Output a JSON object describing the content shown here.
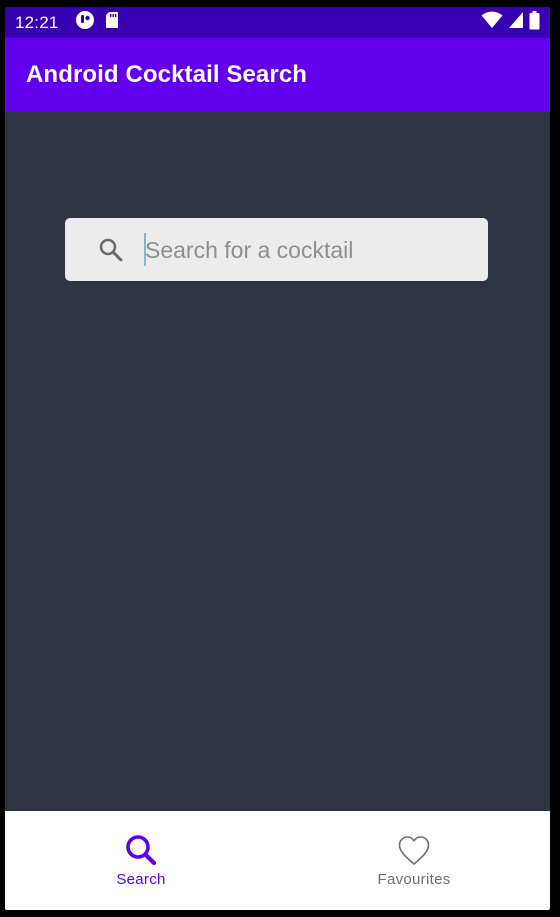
{
  "status_bar": {
    "time": "12:21",
    "left_icons": [
      "notification-app-icon",
      "sd-card-icon"
    ],
    "right_icons": [
      "wifi-icon",
      "signal-icon",
      "battery-icon"
    ]
  },
  "app_bar": {
    "title": "Android Cocktail Search"
  },
  "search": {
    "placeholder": "Search for a cocktail",
    "value": "",
    "icon": "search-icon"
  },
  "bottom_nav": {
    "items": [
      {
        "label": "Search",
        "icon": "search-icon",
        "active": true
      },
      {
        "label": "Favourites",
        "icon": "heart-icon",
        "active": false
      }
    ]
  },
  "colors": {
    "status_bar": "#3700b3",
    "app_bar": "#6200ee",
    "background": "#2f3443",
    "search_box": "#ececec",
    "nav_active": "#6200ee",
    "nav_inactive": "#6f6f6f",
    "caret": "#7fb8c6"
  }
}
